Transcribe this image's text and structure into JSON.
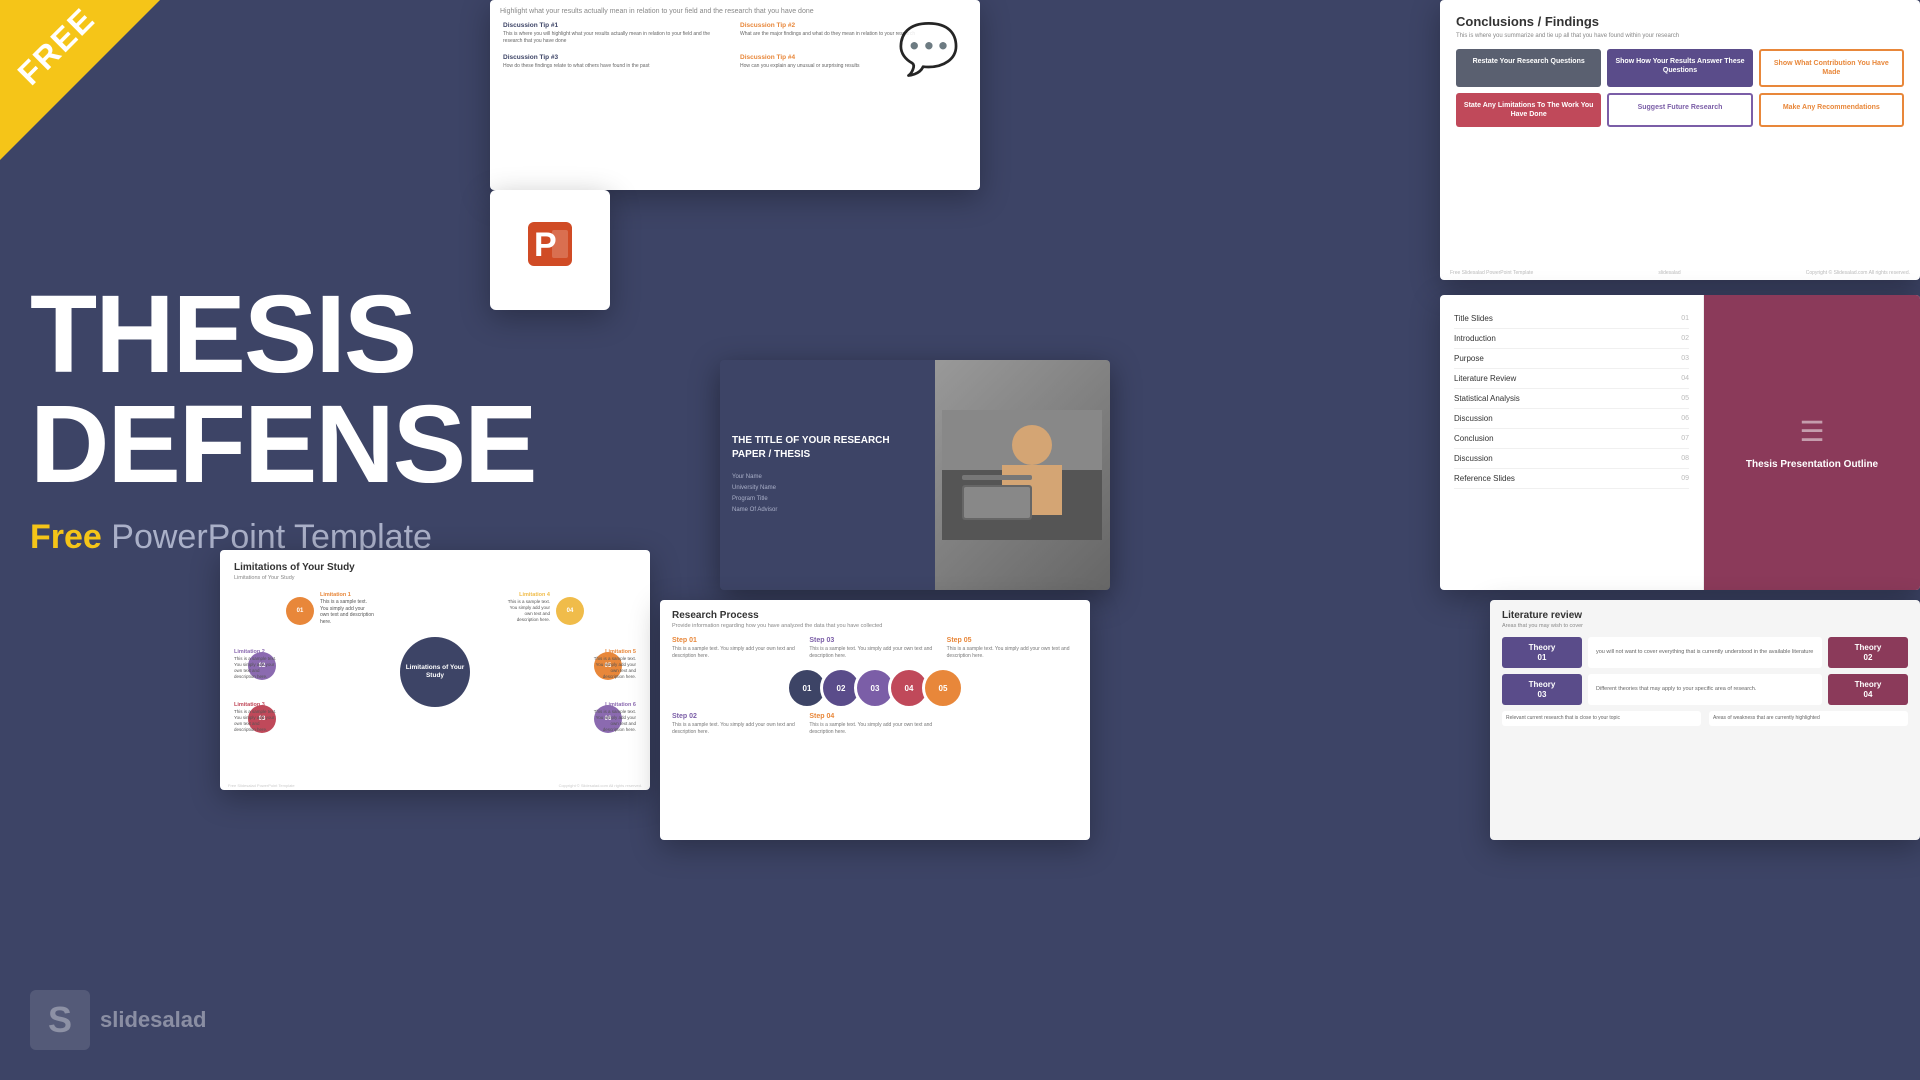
{
  "banner": {
    "free_label": "FREE"
  },
  "main_title": {
    "line1": "THESIS",
    "line2": "DEFENSE",
    "subtitle_free": "Free",
    "subtitle_rest": " PowerPoint Template"
  },
  "logo": {
    "icon": "S",
    "text": "slidesalad"
  },
  "slide_discussion": {
    "header": "Highlight what your results actually mean in relation to your field and the research that you have done",
    "tip1_title": "Discussion Tip #1",
    "tip1_body": "This is where you will highlight what your results actually mean in relation to your field and the research that you have done",
    "tip2_title": "Discussion Tip #2",
    "tip2_body": "What are the major findings and what do they mean in relation to your research",
    "tip3_title": "Discussion Tip #3",
    "tip3_body": "How do these findings relate to what others have found in the past",
    "tip4_title": "Discussion Tip #4",
    "tip4_body": "How can you explain any unusual or surprising results"
  },
  "slide_conclusions": {
    "title": "Conclusions / Findings",
    "subtitle": "This is where you summarize and tie up all that you have found within your research",
    "box1": "Restate Your Research Questions",
    "box2": "Show How Your Results Answer These Questions",
    "box3": "Show What Contribution You Have Made",
    "box4": "State Any Limitations To The Work You Have Done",
    "box5": "Suggest Future Research",
    "box6": "Make Any Recommendations"
  },
  "slide_toc": {
    "title": "Thesis Presentation Outline",
    "items": [
      {
        "label": "Title Slides",
        "num": "01"
      },
      {
        "label": "Introduction",
        "num": "02"
      },
      {
        "label": "Purpose",
        "num": "03"
      },
      {
        "label": "s",
        "num": "04"
      },
      {
        "label": "ical Analysis",
        "num": "05"
      },
      {
        "label": "ion",
        "num": "06"
      },
      {
        "label": "ion",
        "num": "07"
      },
      {
        "label": "ion",
        "num": "08"
      },
      {
        "label": "ce Slides",
        "num": "09"
      }
    ]
  },
  "slide_title_main": {
    "heading": "THE TITLE OF YOUR RESEARCH PAPER / THESIS",
    "name": "Your Name",
    "university": "University Name",
    "program": "Program Title",
    "advisor": "Name Of Advisor"
  },
  "slide_limitations": {
    "title": "Limitations of Your Study",
    "subtitle": "Limitations of Your Study",
    "center": "Limitations of Your Study",
    "nodes": [
      {
        "label": "Limitation 1",
        "num": "01"
      },
      {
        "label": "Limitation 2",
        "num": "02"
      },
      {
        "label": "Limitation 3",
        "num": "03"
      },
      {
        "label": "Limitation 4",
        "num": "04"
      },
      {
        "label": "Limitation 5",
        "num": "05"
      },
      {
        "label": "Limitation 6",
        "num": "06"
      }
    ]
  },
  "slide_research": {
    "title": "Research Process",
    "subtitle": "Provide information regarding how you have analyzed the data that you have collected",
    "steps": [
      {
        "label": "Step 01",
        "body": "This is a sample text. You simply add your own text and description here."
      },
      {
        "label": "Step 03",
        "body": "This is a sample text. You simply add your own text and description here."
      },
      {
        "label": "Step 05",
        "body": "This is a sample text. You simply add your own text and description here."
      },
      {
        "label": "Step 02",
        "body": "This is a sample text. You simply add your own text and description here."
      },
      {
        "label": "Step 04",
        "body": "This is a sample text. You simply add your own text and description here."
      }
    ],
    "circles": [
      "01",
      "02",
      "03",
      "04",
      "05"
    ]
  },
  "slide_litreview": {
    "title": "Literature review",
    "subtitle": "Areas that you may wish to cover",
    "boxes": [
      {
        "label": "Theory\n01"
      },
      {
        "label": "Theory\n02"
      },
      {
        "label": "Theory\n03"
      },
      {
        "label": "Theory\n04"
      }
    ],
    "texts": [
      "you will not want to cover everything that is currently understood in the available literature",
      "Relevant current research that is close to your topic",
      "Different theories that may apply to your specific area of research.",
      "Areas of weakness that are currently highlighted"
    ]
  }
}
